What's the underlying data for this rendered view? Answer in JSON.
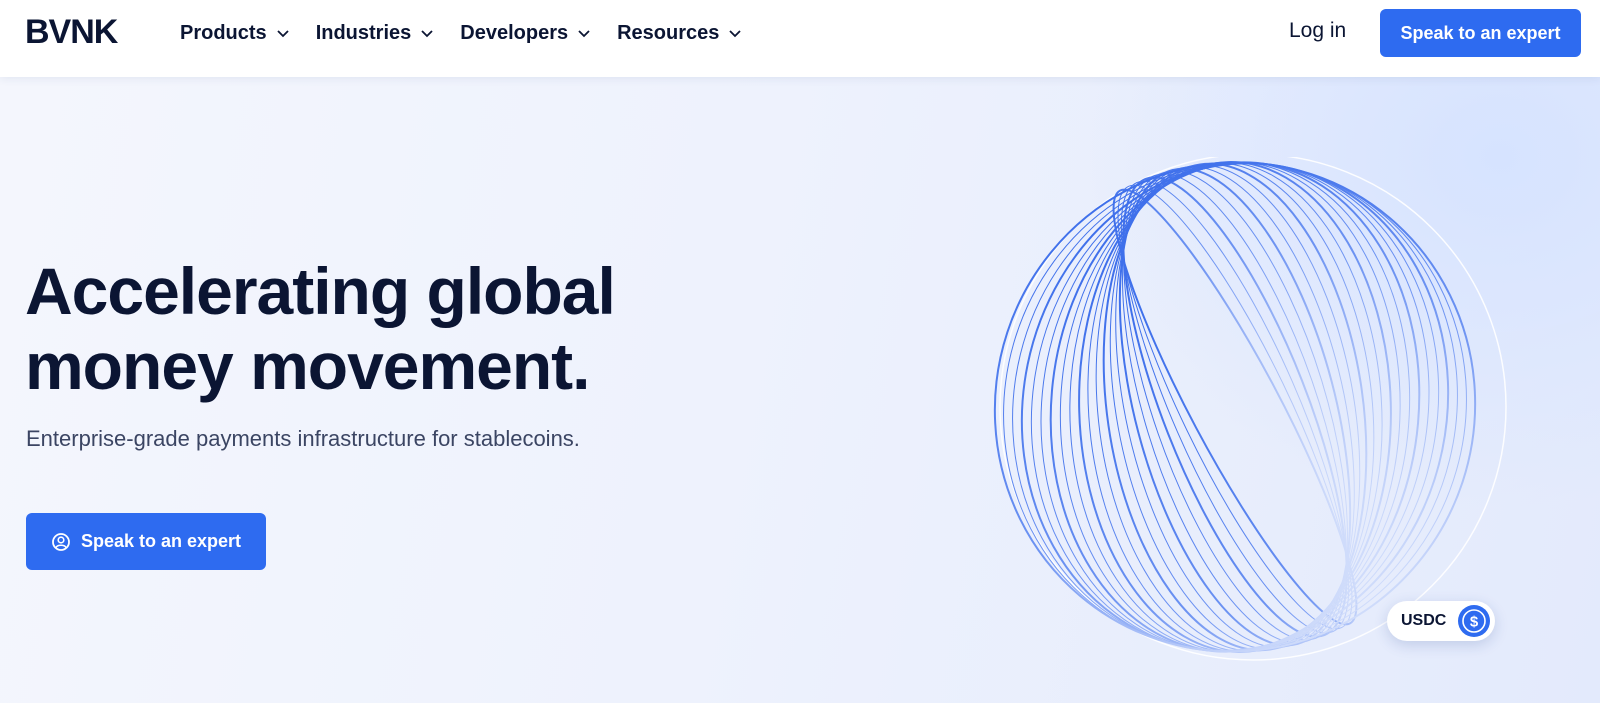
{
  "nav": {
    "logo": "BVNK",
    "menu": [
      {
        "label": "Products"
      },
      {
        "label": "Industries"
      },
      {
        "label": "Developers"
      },
      {
        "label": "Resources"
      }
    ],
    "login": "Log in",
    "cta": "Speak to an expert"
  },
  "hero": {
    "headline": "Accelerating global money movement.",
    "subhead": "Enterprise-grade payments infrastructure for stablecoins.",
    "cta": "Speak to an expert",
    "badge": "USDC"
  },
  "colors": {
    "accent": "#2e6bf0",
    "text": "#0b1533"
  }
}
